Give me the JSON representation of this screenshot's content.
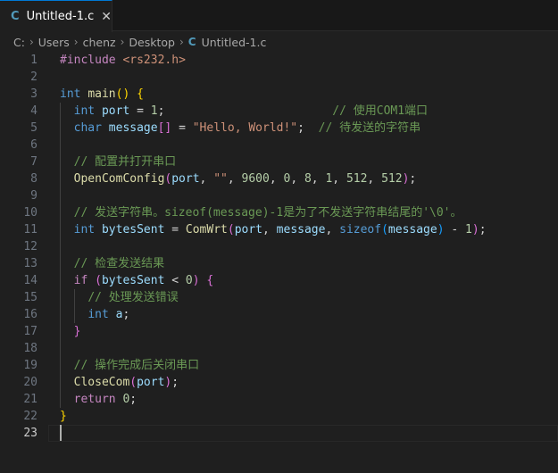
{
  "tab": {
    "icon": "c-file-icon",
    "icon_glyph": "C",
    "label": "Untitled-1.c",
    "close_glyph": "✕"
  },
  "breadcrumb": {
    "items": [
      "C:",
      "Users",
      "chenz",
      "Desktop"
    ],
    "file_icon_glyph": "C",
    "file": "Untitled-1.c",
    "separator": "›"
  },
  "editor": {
    "active_line": 23,
    "lines": [
      {
        "n": "1",
        "tokens": [
          [
            "pp",
            "#include "
          ],
          [
            "str",
            "<rs232.h>"
          ]
        ]
      },
      {
        "n": "2",
        "tokens": []
      },
      {
        "n": "3",
        "tokens": [
          [
            "kw",
            "int"
          ],
          [
            "plain",
            " "
          ],
          [
            "fn",
            "main"
          ],
          [
            "br1",
            "()"
          ],
          [
            "plain",
            " "
          ],
          [
            "br1",
            "{"
          ]
        ]
      },
      {
        "n": "4",
        "tokens": [
          [
            "plain",
            "  "
          ],
          [
            "kw",
            "int"
          ],
          [
            "plain",
            " "
          ],
          [
            "var",
            "port"
          ],
          [
            "plain",
            " = "
          ],
          [
            "num",
            "1"
          ],
          [
            "plain",
            ";                        "
          ],
          [
            "com",
            "// 使用COM1端口"
          ]
        ]
      },
      {
        "n": "5",
        "tokens": [
          [
            "plain",
            "  "
          ],
          [
            "kw",
            "char"
          ],
          [
            "plain",
            " "
          ],
          [
            "var",
            "message"
          ],
          [
            "br2",
            "[]"
          ],
          [
            "plain",
            " = "
          ],
          [
            "str",
            "\"Hello, World!\""
          ],
          [
            "plain",
            ";  "
          ],
          [
            "com",
            "// 待发送的字符串"
          ]
        ]
      },
      {
        "n": "6",
        "tokens": []
      },
      {
        "n": "7",
        "tokens": [
          [
            "plain",
            "  "
          ],
          [
            "com",
            "// 配置并打开串口"
          ]
        ]
      },
      {
        "n": "8",
        "tokens": [
          [
            "plain",
            "  "
          ],
          [
            "fn",
            "OpenComConfig"
          ],
          [
            "br2",
            "("
          ],
          [
            "var",
            "port"
          ],
          [
            "plain",
            ", "
          ],
          [
            "str",
            "\"\""
          ],
          [
            "plain",
            ", "
          ],
          [
            "num",
            "9600"
          ],
          [
            "plain",
            ", "
          ],
          [
            "num",
            "0"
          ],
          [
            "plain",
            ", "
          ],
          [
            "num",
            "8"
          ],
          [
            "plain",
            ", "
          ],
          [
            "num",
            "1"
          ],
          [
            "plain",
            ", "
          ],
          [
            "num",
            "512"
          ],
          [
            "plain",
            ", "
          ],
          [
            "num",
            "512"
          ],
          [
            "br2",
            ")"
          ],
          [
            "plain",
            ";"
          ]
        ]
      },
      {
        "n": "9",
        "tokens": []
      },
      {
        "n": "10",
        "tokens": [
          [
            "plain",
            "  "
          ],
          [
            "com",
            "// 发送字符串。sizeof(message)-1是为了不发送字符串结尾的'\\0'。"
          ]
        ]
      },
      {
        "n": "11",
        "tokens": [
          [
            "plain",
            "  "
          ],
          [
            "kw",
            "int"
          ],
          [
            "plain",
            " "
          ],
          [
            "var",
            "bytesSent"
          ],
          [
            "plain",
            " = "
          ],
          [
            "fn",
            "ComWrt"
          ],
          [
            "br2",
            "("
          ],
          [
            "var",
            "port"
          ],
          [
            "plain",
            ", "
          ],
          [
            "var",
            "message"
          ],
          [
            "plain",
            ", "
          ],
          [
            "kw",
            "sizeof"
          ],
          [
            "br3",
            "("
          ],
          [
            "var",
            "message"
          ],
          [
            "br3",
            ")"
          ],
          [
            "plain",
            " - "
          ],
          [
            "num",
            "1"
          ],
          [
            "br2",
            ")"
          ],
          [
            "plain",
            ";"
          ]
        ]
      },
      {
        "n": "12",
        "tokens": []
      },
      {
        "n": "13",
        "tokens": [
          [
            "plain",
            "  "
          ],
          [
            "com",
            "// 检查发送结果"
          ]
        ]
      },
      {
        "n": "14",
        "tokens": [
          [
            "plain",
            "  "
          ],
          [
            "ctrl",
            "if"
          ],
          [
            "plain",
            " "
          ],
          [
            "br2",
            "("
          ],
          [
            "var",
            "bytesSent"
          ],
          [
            "plain",
            " < "
          ],
          [
            "num",
            "0"
          ],
          [
            "br2",
            ")"
          ],
          [
            "plain",
            " "
          ],
          [
            "br2",
            "{"
          ]
        ]
      },
      {
        "n": "15",
        "tokens": [
          [
            "plain",
            "    "
          ],
          [
            "com",
            "// 处理发送错误"
          ]
        ]
      },
      {
        "n": "16",
        "tokens": [
          [
            "plain",
            "    "
          ],
          [
            "kw",
            "int"
          ],
          [
            "plain",
            " "
          ],
          [
            "var",
            "a"
          ],
          [
            "plain",
            ";"
          ]
        ]
      },
      {
        "n": "17",
        "tokens": [
          [
            "plain",
            "  "
          ],
          [
            "br2",
            "}"
          ]
        ]
      },
      {
        "n": "18",
        "tokens": []
      },
      {
        "n": "19",
        "tokens": [
          [
            "plain",
            "  "
          ],
          [
            "com",
            "// 操作完成后关闭串口"
          ]
        ]
      },
      {
        "n": "20",
        "tokens": [
          [
            "plain",
            "  "
          ],
          [
            "fn",
            "CloseCom"
          ],
          [
            "br2",
            "("
          ],
          [
            "var",
            "port"
          ],
          [
            "br2",
            ")"
          ],
          [
            "plain",
            ";"
          ]
        ]
      },
      {
        "n": "21",
        "tokens": [
          [
            "plain",
            "  "
          ],
          [
            "ctrl",
            "return"
          ],
          [
            "plain",
            " "
          ],
          [
            "num",
            "0"
          ],
          [
            "plain",
            ";"
          ]
        ]
      },
      {
        "n": "22",
        "tokens": [
          [
            "br1",
            "}"
          ]
        ]
      },
      {
        "n": "23",
        "tokens": []
      }
    ]
  }
}
